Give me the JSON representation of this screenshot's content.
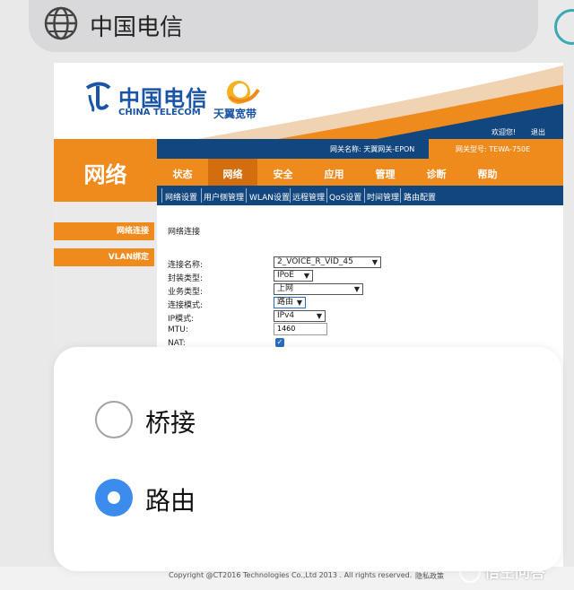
{
  "browser": {
    "address_text": "中国电信",
    "icon": "globe-icon"
  },
  "header": {
    "logo_ct": "中国电信",
    "logo_ct_sub": "CHINA TELECOM",
    "logo_ty": "天翼宽带",
    "welcome": "欢迎您!",
    "logout": "退出",
    "gateway_name_label": "网关名称:",
    "gateway_name": "天翼网关-EPON",
    "gateway_model_label": "网关型号:",
    "gateway_model": "TEWA-750E"
  },
  "section_title": "网络",
  "sidebar": {
    "items": [
      {
        "label": "网络连接"
      },
      {
        "label": "VLAN绑定"
      }
    ]
  },
  "nav": {
    "tabs": [
      {
        "label": "状态"
      },
      {
        "label": "网络"
      },
      {
        "label": "安全"
      },
      {
        "label": "应用"
      },
      {
        "label": "管理"
      },
      {
        "label": "诊断"
      },
      {
        "label": "帮助"
      }
    ],
    "active_tab": "网络",
    "subtabs": [
      {
        "label": "网络设置"
      },
      {
        "label": "用户侧管理"
      },
      {
        "label": "WLAN设置"
      },
      {
        "label": "远程管理"
      },
      {
        "label": "QoS设置"
      },
      {
        "label": "时间管理"
      },
      {
        "label": "路由配置"
      }
    ]
  },
  "content": {
    "title": "网络连接",
    "fields": {
      "conn_name": {
        "label": "连接名称:",
        "value": "2_VOICE_R_VID_45"
      },
      "encap": {
        "label": "封装类型:",
        "value": "IPoE"
      },
      "service": {
        "label": "业务类型:",
        "value": "上网"
      },
      "conn_mode": {
        "label": "连接模式:",
        "value": "路由"
      },
      "ip_mode": {
        "label": "IP模式:",
        "value": "IPv4"
      },
      "mtu": {
        "label": "MTU:",
        "value": "1460"
      },
      "nat": {
        "label": "NAT:",
        "checked": true
      }
    }
  },
  "footer": {
    "copyright": "Copyright @CT2016 Technologies Co.,Ltd 2013 . All rights reserved.",
    "privacy": "隐私政策",
    "watermark": "悟空问答"
  },
  "dialog": {
    "options": [
      {
        "label": "桥接",
        "selected": false
      },
      {
        "label": "路由",
        "selected": true
      }
    ]
  },
  "colors": {
    "orange": "#ef8a1c",
    "navy": "#12467e",
    "radio_selected": "#3b8ced",
    "brand_blue": "#1a54a5"
  }
}
